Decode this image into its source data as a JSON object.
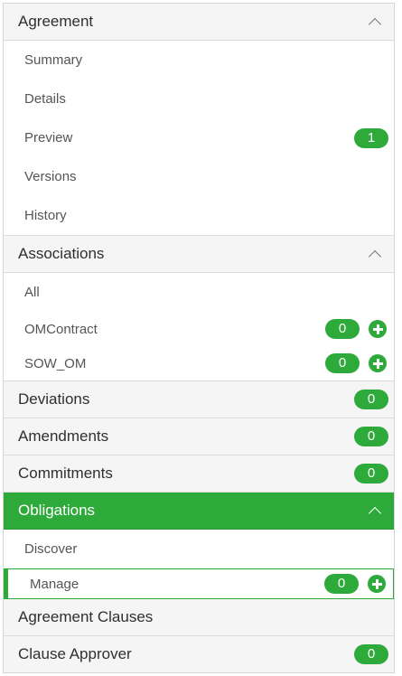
{
  "agreement": {
    "header": "Agreement",
    "items": [
      {
        "label": "Summary"
      },
      {
        "label": "Details"
      },
      {
        "label": "Preview",
        "badge": "1"
      },
      {
        "label": "Versions"
      },
      {
        "label": "History"
      }
    ]
  },
  "associations": {
    "header": "Associations",
    "items": [
      {
        "label": "All"
      },
      {
        "label": "OMContract",
        "badge": "0"
      },
      {
        "label": "SOW_OM",
        "badge": "0"
      }
    ]
  },
  "deviations": {
    "label": "Deviations",
    "badge": "0"
  },
  "amendments": {
    "label": "Amendments",
    "badge": "0"
  },
  "commitments": {
    "label": "Commitments",
    "badge": "0"
  },
  "obligations": {
    "header": "Obligations",
    "items": [
      {
        "label": "Discover"
      },
      {
        "label": "Manage",
        "badge": "0"
      }
    ]
  },
  "agreement_clauses": {
    "label": "Agreement Clauses"
  },
  "clause_approver": {
    "label": "Clause Approver",
    "badge": "0"
  },
  "colors": {
    "accent": "#2eaa3b",
    "section_bg": "#f5f5f5",
    "border": "#dcdcdc"
  }
}
